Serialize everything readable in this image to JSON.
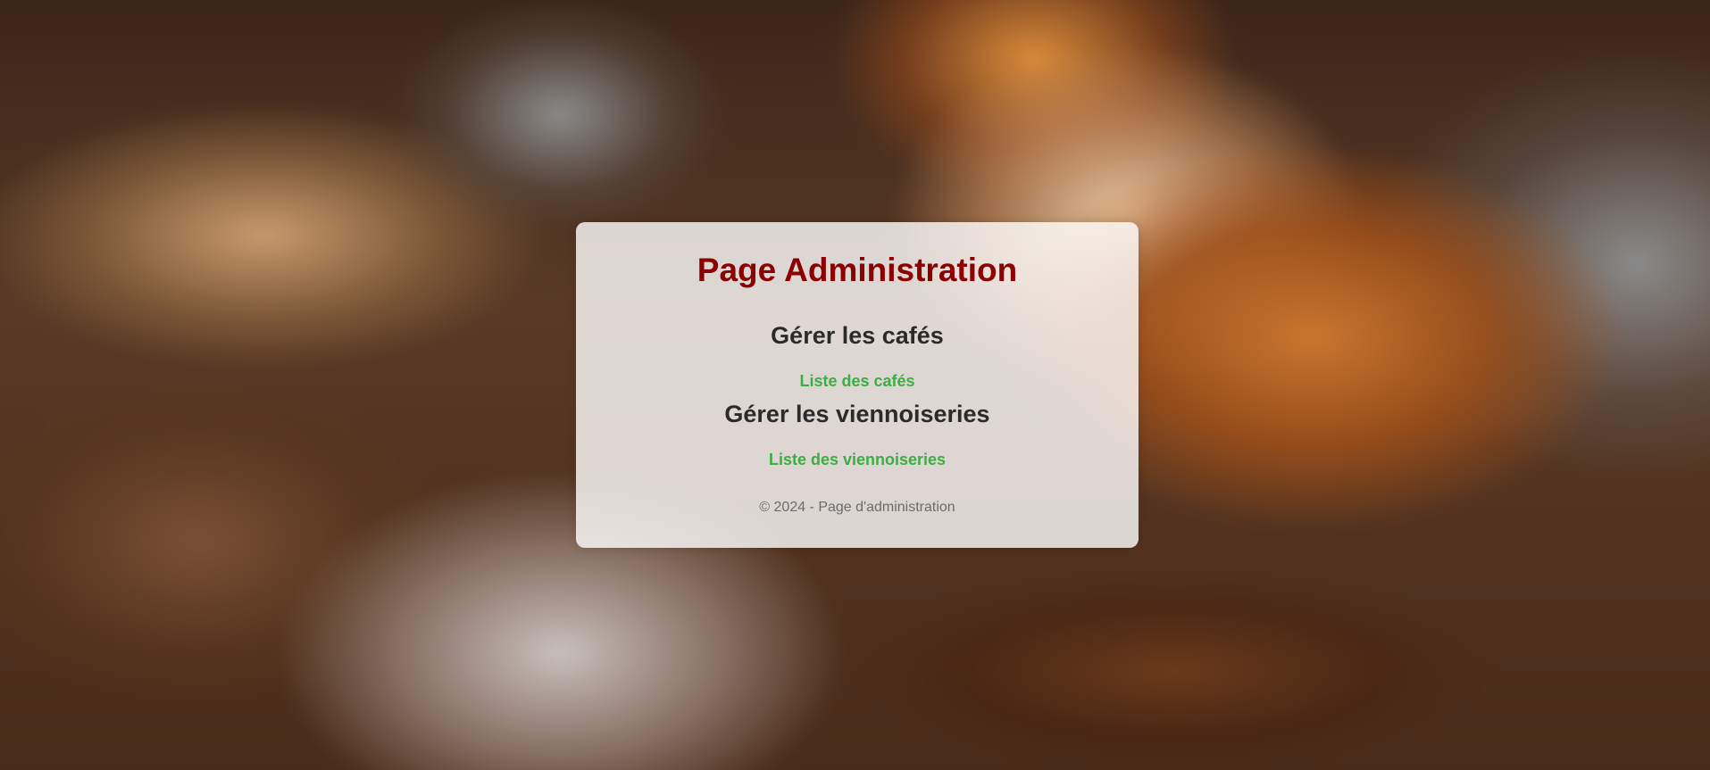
{
  "page": {
    "title": "Page Administration"
  },
  "sections": [
    {
      "heading": "Gérer les cafés",
      "link_label": "Liste des cafés"
    },
    {
      "heading": "Gérer les viennoiseries",
      "link_label": "Liste des viennoiseries"
    }
  ],
  "footer": {
    "text": "© 2024 - Page d'administration"
  },
  "colors": {
    "title": "#8b0000",
    "link": "#3cae43",
    "heading": "#2b2b2b",
    "footer": "#6b6b6b"
  }
}
